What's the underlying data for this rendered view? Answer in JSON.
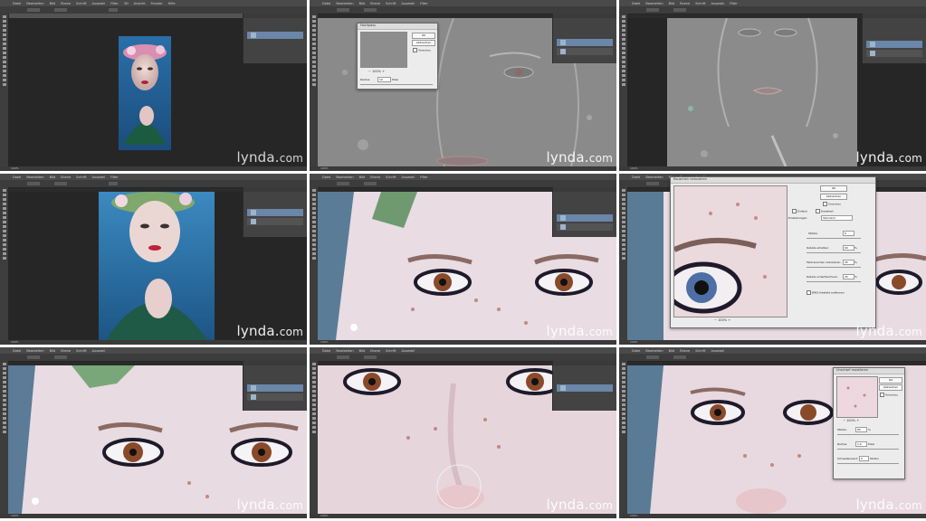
{
  "watermark": {
    "brand": "lynda",
    "dot": ".",
    "tld": "com"
  },
  "photoshop": {
    "menu": [
      "Datei",
      "Bearbeiten",
      "Bild",
      "Ebene",
      "Schrift",
      "Auswahl",
      "Filter",
      "3D",
      "Ansicht",
      "Fenster",
      "Hilfe"
    ],
    "mode_value": "Normal",
    "zoom_status": "100%"
  },
  "tiles": [
    {
      "id": "overview-color"
    },
    {
      "id": "hochpass-dialog",
      "dialog": {
        "title": "Hochpass",
        "ok": "OK",
        "cancel": "Abbrechen",
        "preview": "Vorschau",
        "zoom": "100%",
        "radius_label": "Radius:",
        "radius_value": "10",
        "radius_unit": "Pixel"
      }
    },
    {
      "id": "highpass-result"
    },
    {
      "id": "overview-sharpened"
    },
    {
      "id": "eyes-closeup"
    },
    {
      "id": "rauschen-dialog",
      "dialog": {
        "title": "Rauschen reduzieren",
        "ok": "OK",
        "cancel": "Abbrechen",
        "preview": "Vorschau",
        "basic": "Einfach",
        "advanced": "Erweitert",
        "settings_label": "Einstellungen:",
        "settings_value": "Standard",
        "strength": "Stärke:",
        "strength_value": "6",
        "detail": "Details erhalten:",
        "detail_value": "60",
        "detail_unit": "%",
        "color_noise": "Farbrauschen reduzieren:",
        "color_value": "45",
        "color_unit": "%",
        "sharpen": "Details scharfzeichnen:",
        "sharpen_value": "25",
        "sharpen_unit": "%",
        "jpeg": "JPEG-Artefakt entfernen",
        "zoom": "100%"
      }
    },
    {
      "id": "eyes-layers"
    },
    {
      "id": "nose-brush"
    },
    {
      "id": "unscharf-dialog",
      "dialog": {
        "title": "Unscharf maskieren",
        "ok": "OK",
        "cancel": "Abbrechen",
        "preview": "Vorschau",
        "zoom": "100%",
        "amount_label": "Stärke:",
        "amount_value": "85",
        "amount_unit": "%",
        "radius_label": "Radius:",
        "radius_value": "1,0",
        "radius_unit": "Pixel",
        "threshold_label": "Schwellenwert:",
        "threshold_value": "0",
        "threshold_unit": "Stufen"
      }
    }
  ]
}
